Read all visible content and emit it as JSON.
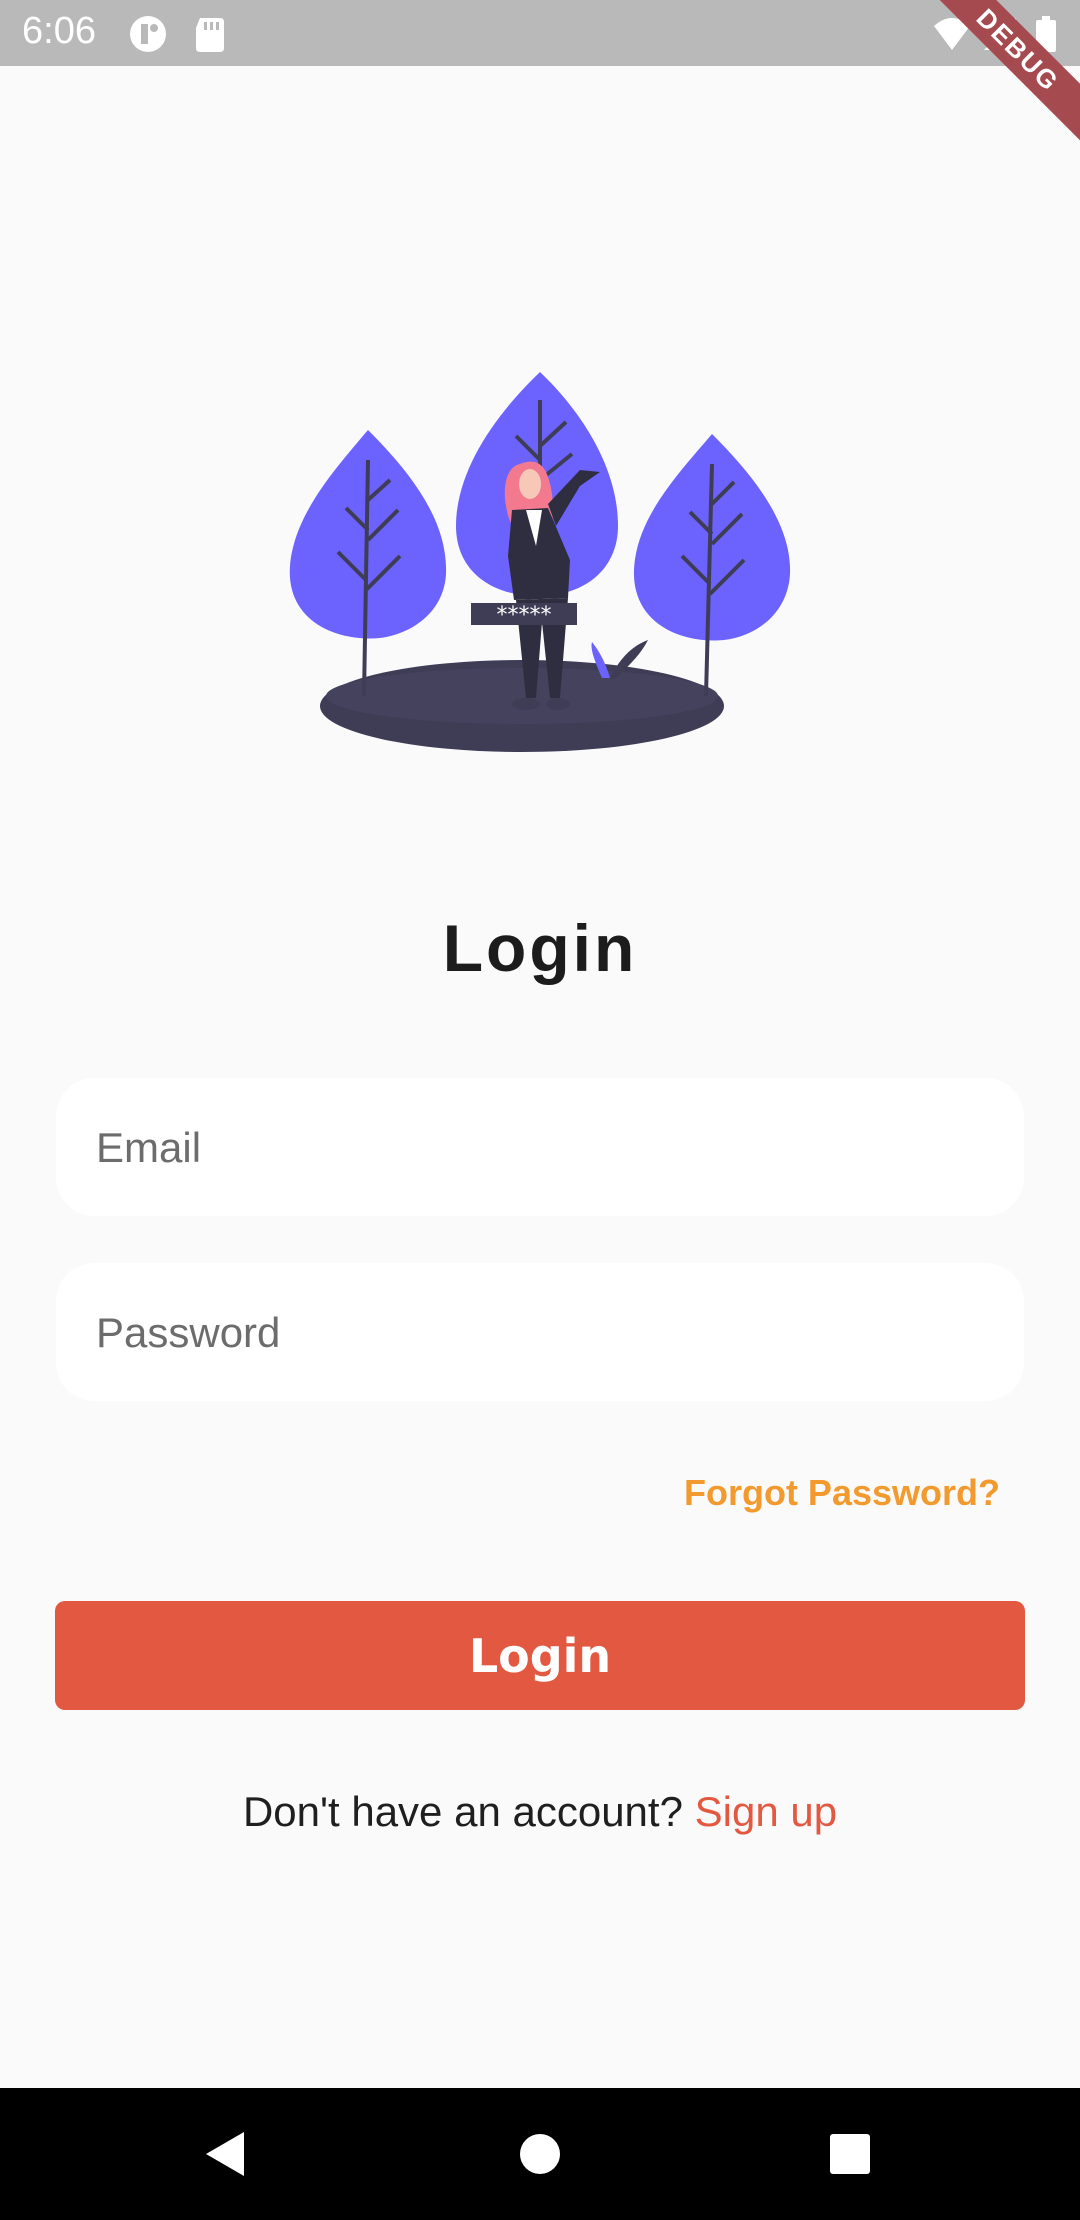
{
  "status_bar": {
    "time": "6:06",
    "debug_label": "DEBUG",
    "icons": [
      "app-notification-icon",
      "sd-card-icon",
      "wifi-icon",
      "signal-icon",
      "battery-icon"
    ]
  },
  "illustration": {
    "name": "login-illustration",
    "password_mask": "*****",
    "colors": {
      "tree": "#6c63ff",
      "ground": "#3f3d56",
      "hair": "#f37a8e",
      "suit": "#2f2e41"
    }
  },
  "login": {
    "title": "Login",
    "email_placeholder": "Email",
    "password_placeholder": "Password",
    "forgot_password": "Forgot Password?",
    "button_label": "Login",
    "no_account_text": "Don't have an account? ",
    "signup_label": "Sign up"
  },
  "colors": {
    "accent": "#e35840",
    "forgot": "#f29a2e",
    "background": "#fafafa"
  },
  "nav_bar": {
    "buttons": [
      "back-icon",
      "home-icon",
      "recents-icon"
    ]
  }
}
